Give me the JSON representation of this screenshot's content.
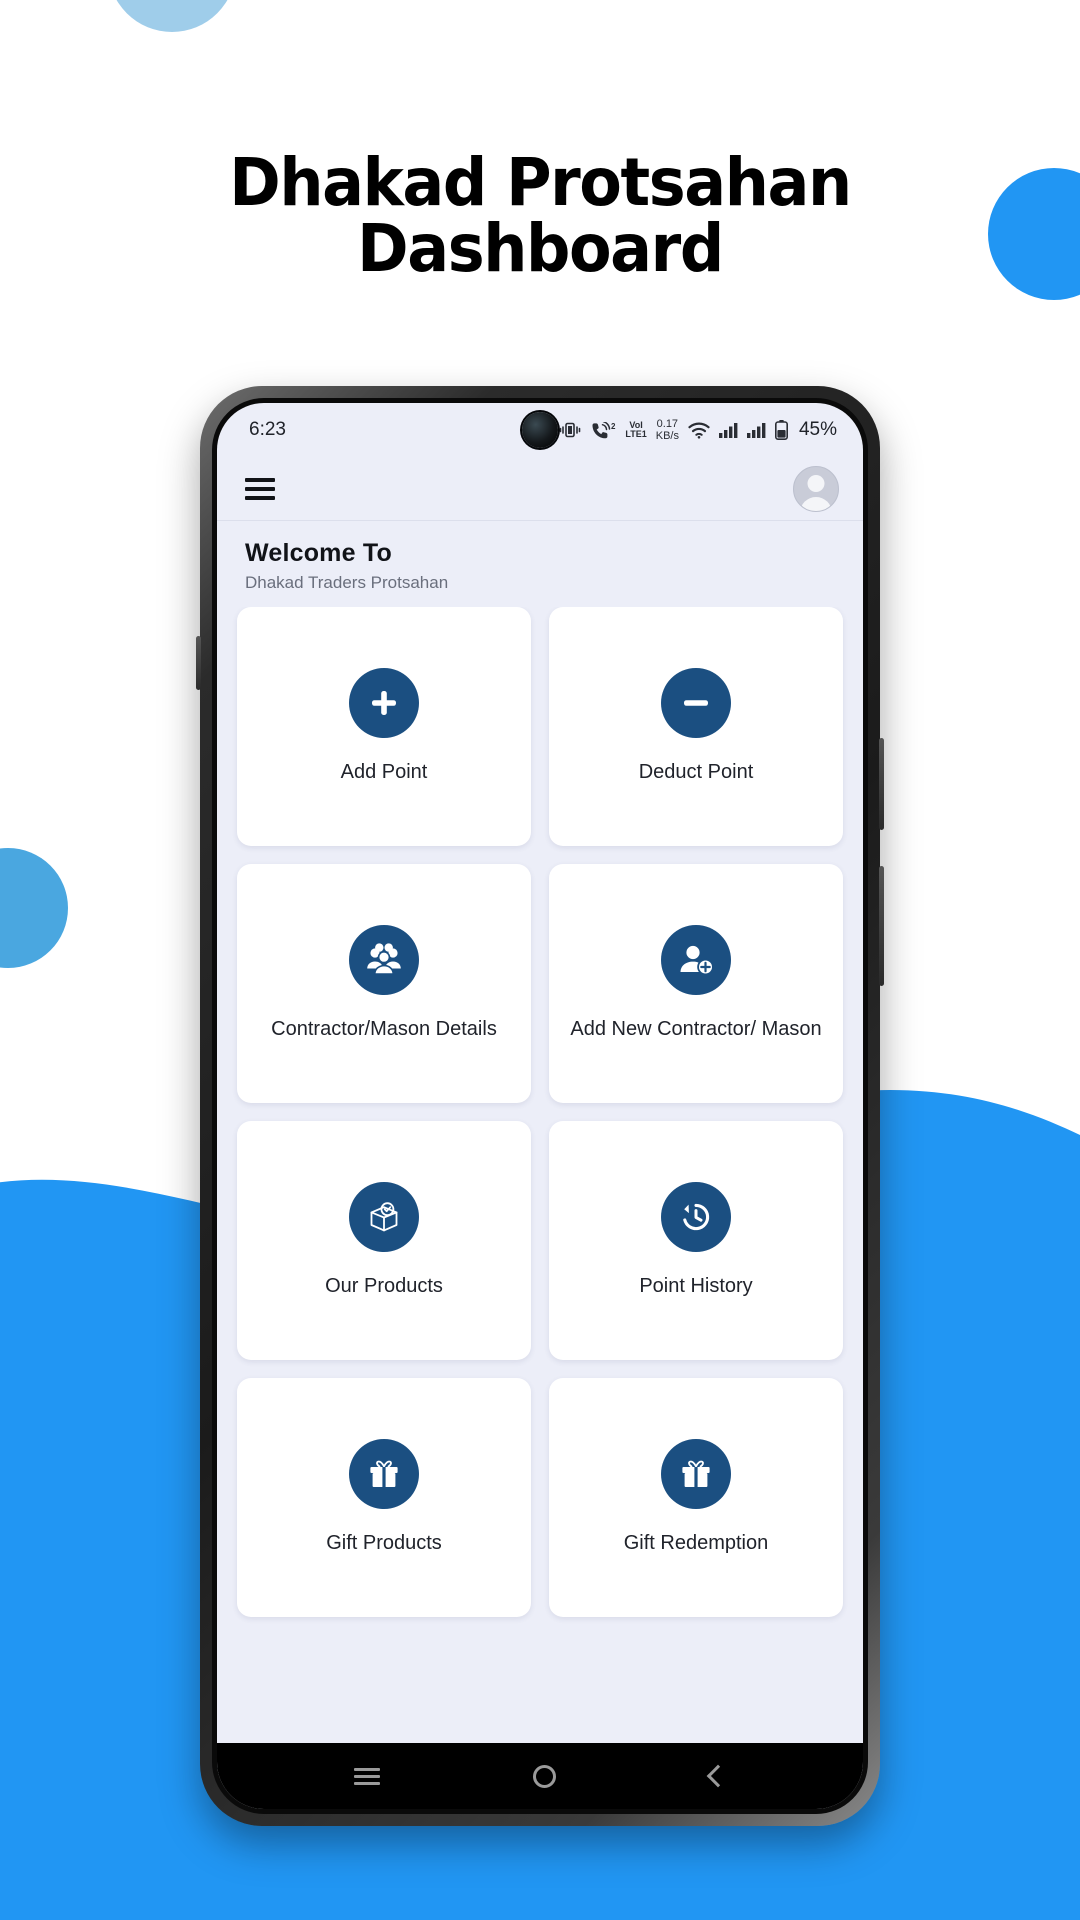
{
  "poster": {
    "title_line1": "Dhakad Protsahan",
    "title_line2": "Dashboard",
    "colors": {
      "background": "#ffffff",
      "wave_blue": "#2196f3",
      "circle_light": "#9fcdea",
      "circle_mid": "#4aa7e0",
      "brand_navy": "#1b4f81"
    }
  },
  "status_bar": {
    "time": "6:23",
    "vibrate_icon": "vibrate-icon",
    "call_icon": "call-sim-icon",
    "call_sim_badge": "2",
    "volte_line1": "VoI",
    "volte_line2": "LTE1",
    "net_speed_value": "0.17",
    "net_speed_unit": "KB/s",
    "wifi_icon": "wifi-icon",
    "signal_icon_1": "signal-bars-icon",
    "signal_icon_2": "signal-bars-icon",
    "battery_icon": "battery-icon",
    "battery_level": "45%"
  },
  "app_bar": {
    "menu_icon": "hamburger-menu-icon",
    "avatar_icon": "user-avatar-icon"
  },
  "welcome": {
    "title": "Welcome To",
    "subtitle": "Dhakad Traders Protsahan"
  },
  "grid": {
    "cards": [
      {
        "label": "Add Point",
        "icon": "plus-circle-icon"
      },
      {
        "label": "Deduct Point",
        "icon": "minus-circle-icon"
      },
      {
        "label": "Contractor/Mason Details",
        "icon": "people-group-icon"
      },
      {
        "label": "Add New Contractor/ Mason",
        "icon": "person-add-icon"
      },
      {
        "label": "Our Products",
        "icon": "box-check-icon"
      },
      {
        "label": "Point History",
        "icon": "history-clock-icon"
      },
      {
        "label": "Gift Products",
        "icon": "gift-box-icon"
      },
      {
        "label": "Gift Redemption",
        "icon": "gift-box-icon"
      }
    ]
  },
  "android_nav": {
    "recents_label": "recents-icon",
    "home_label": "home-icon",
    "back_label": "back-icon"
  }
}
